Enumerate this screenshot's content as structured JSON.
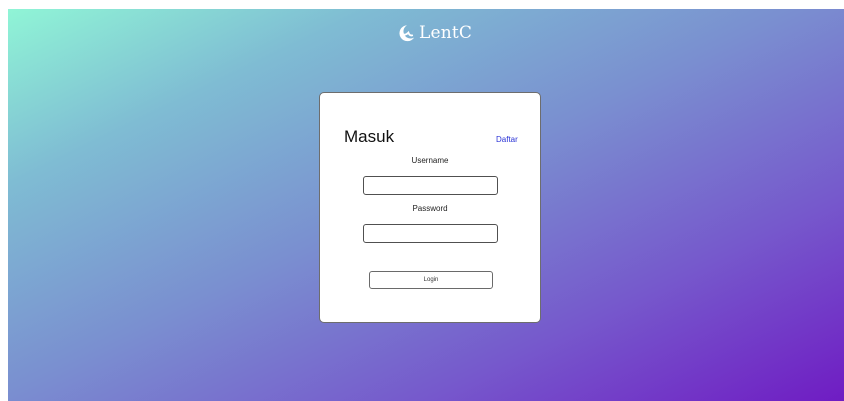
{
  "brand": {
    "name": "LentC",
    "icon": "moon-icon"
  },
  "login_card": {
    "title": "Masuk",
    "register_link": "Daftar",
    "username_label": "Username",
    "username_value": "",
    "password_label": "Password",
    "password_value": "",
    "login_button": "Login"
  },
  "colors": {
    "gradient_start": "#90f5d6",
    "gradient_end": "#6f1cc3",
    "link": "#2a33d6",
    "card_background": "#ffffff"
  }
}
